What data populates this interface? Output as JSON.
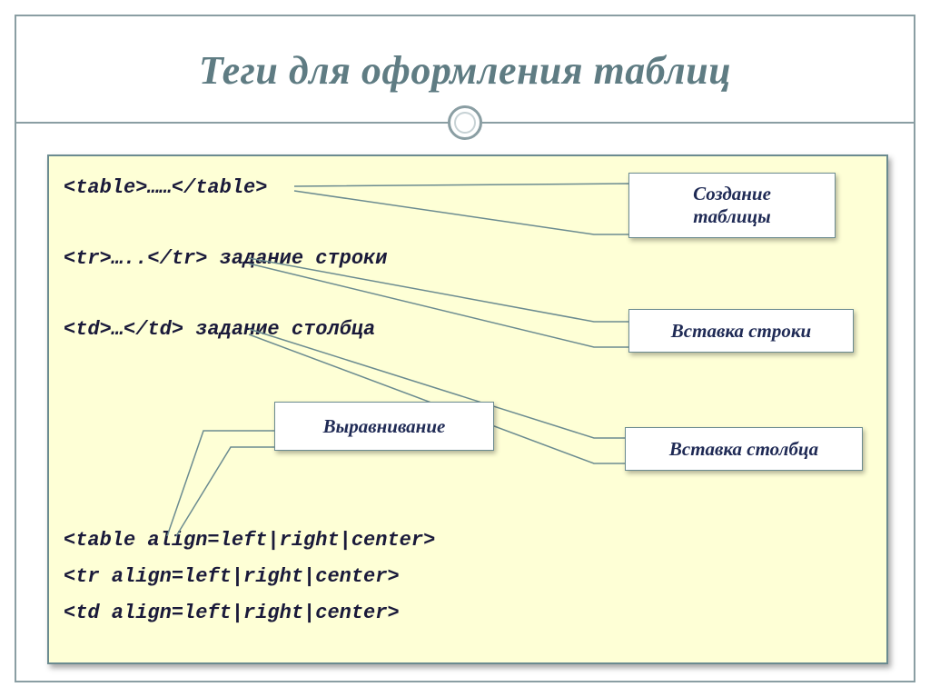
{
  "title": "Теги для оформления таблиц",
  "code": {
    "l1": "<table>……</table>",
    "l2": "<tr>…..</tr> задание строки",
    "l3": "<td>…</td> задание столбца",
    "l4": "<table align=left|right|center>",
    "l5": "<tr align=left|right|center>",
    "l6": "<td align=left|right|center>"
  },
  "callouts": {
    "create": "Создание\nтаблицы",
    "row": "Вставка строки",
    "col": "Вставка столбца",
    "align": "Выравнивание"
  }
}
